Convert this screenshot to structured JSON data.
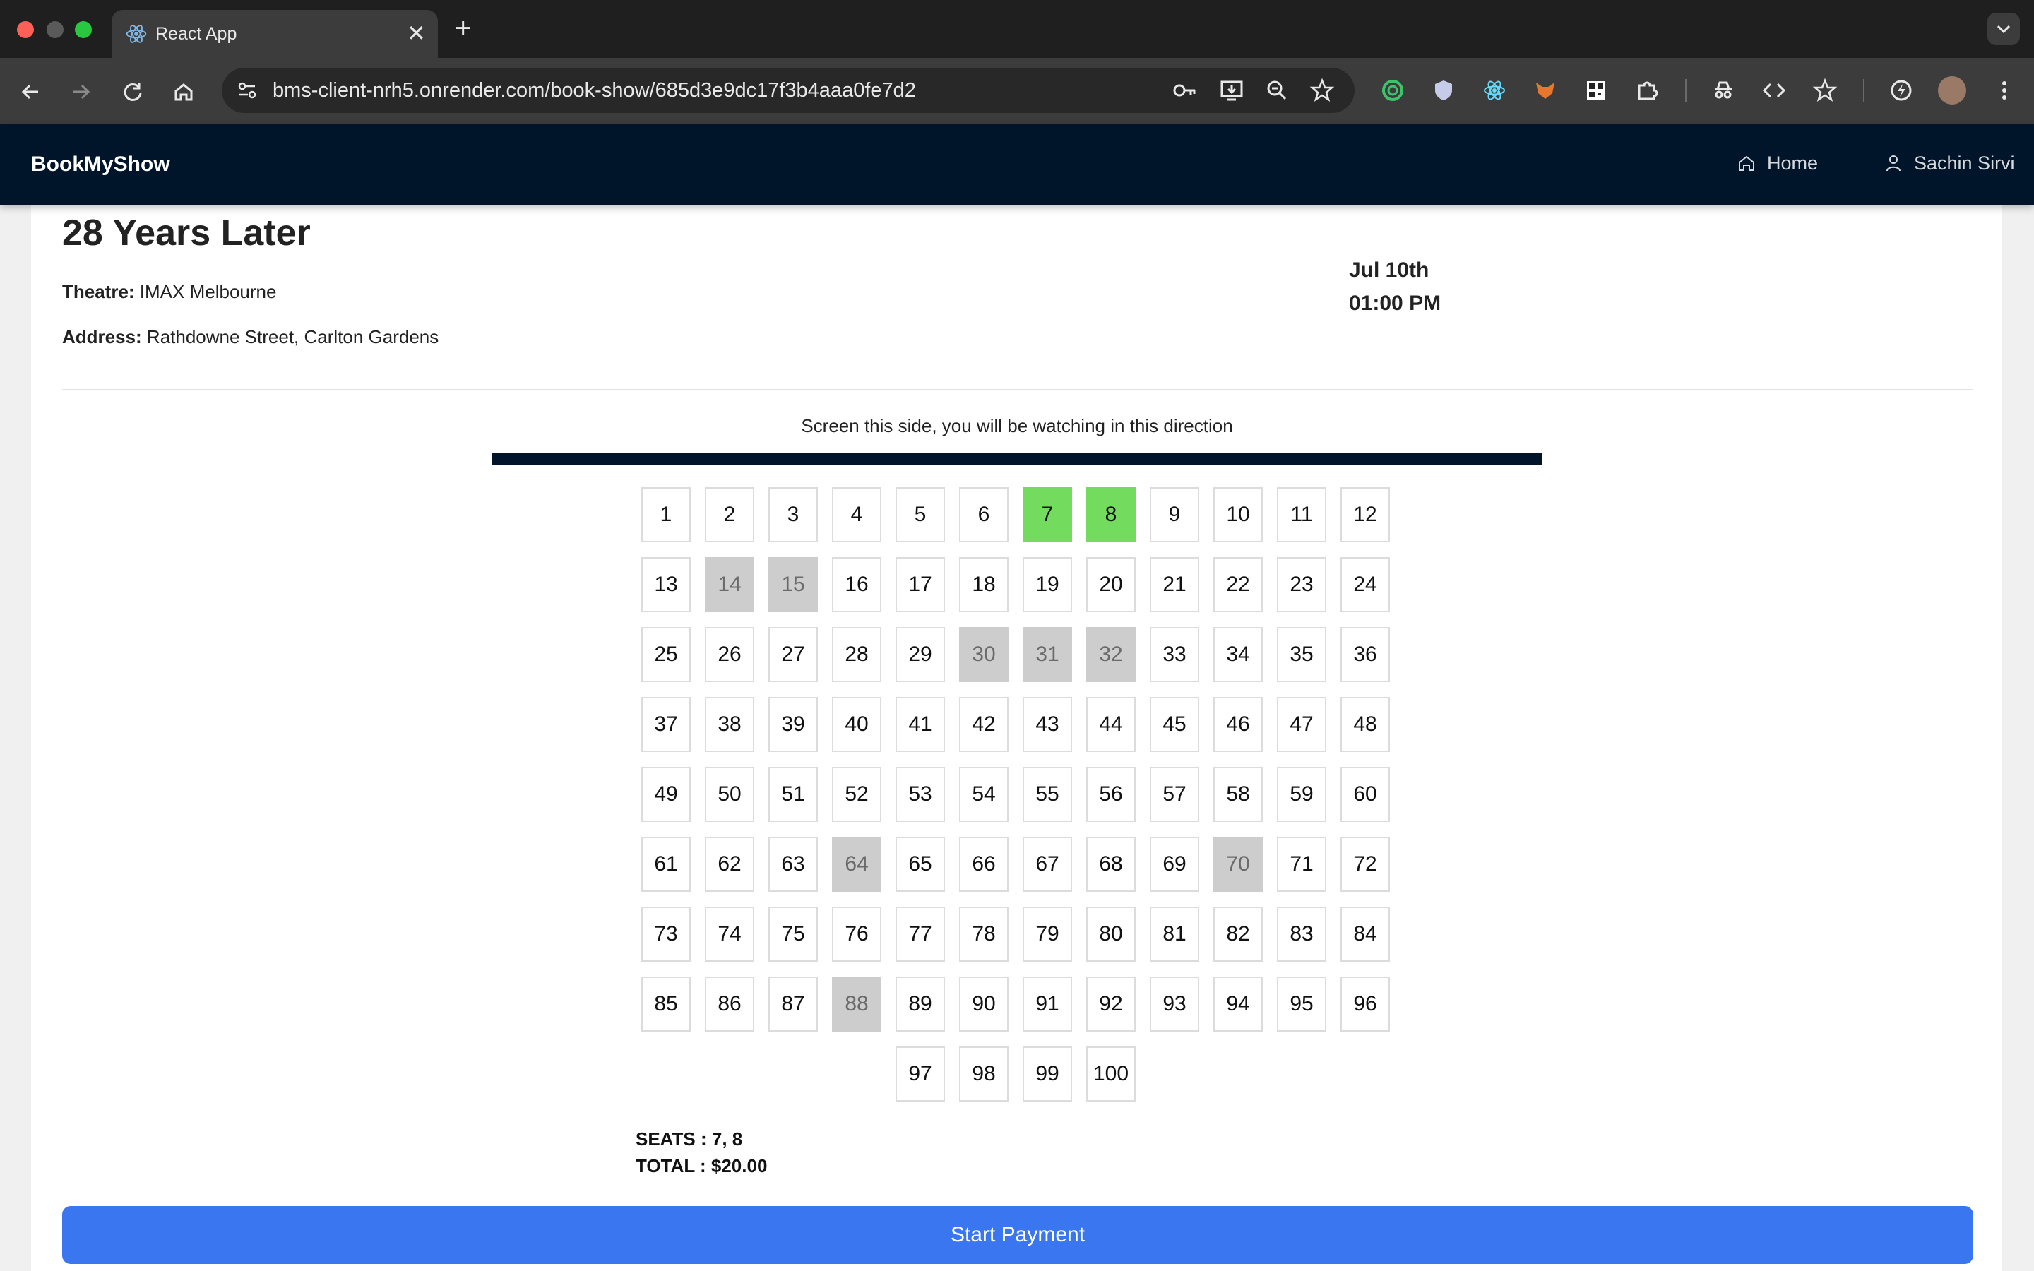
{
  "browser": {
    "tab_title": "React App",
    "tab_close": "✕",
    "new_tab": "+",
    "url": "bms-client-nrh5.onrender.com/book-show/685d3e9dc17f3b4aaa0fe7d2"
  },
  "app": {
    "brand": "BookMyShow",
    "nav_home": "Home",
    "nav_user": "Sachin Sirvi"
  },
  "show": {
    "movie_title": "28 Years Later",
    "theatre_label": "Theatre:",
    "theatre_value": " IMAX Melbourne",
    "address_label": "Address:",
    "address_value": " Rathdowne Street, Carlton Gardens",
    "date": "Jul 10th",
    "time": "01:00 PM"
  },
  "seating": {
    "screen_text": "Screen this side, you will be watching in this direction",
    "total_seats": 100,
    "seats_per_row": 12,
    "booked_seats": [
      14,
      15,
      30,
      31,
      32,
      64,
      70,
      88
    ],
    "selected_seats": [
      7,
      8
    ]
  },
  "summary": {
    "seats_line": "SEATS : 7, 8",
    "total_line": "TOTAL : $20.00"
  },
  "payment": {
    "button_label": "Start Payment"
  }
}
